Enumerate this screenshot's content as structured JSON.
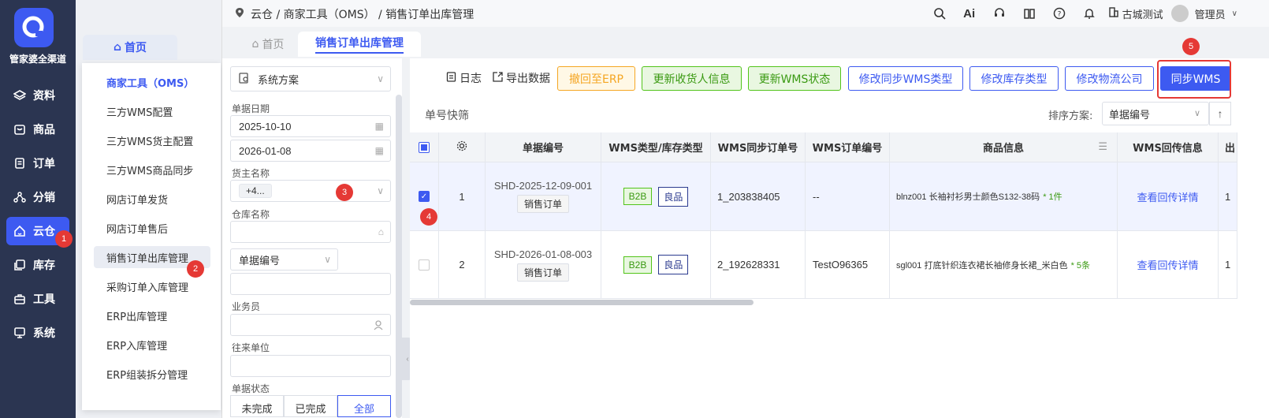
{
  "app": {
    "brand": "管家婆全渠道"
  },
  "nav": [
    {
      "label": "资料",
      "icon": "layers-icon"
    },
    {
      "label": "商品",
      "icon": "shop-icon"
    },
    {
      "label": "订单",
      "icon": "doc-icon"
    },
    {
      "label": "分销",
      "icon": "network-icon"
    },
    {
      "label": "云仓",
      "icon": "cloud-home-icon",
      "active": true
    },
    {
      "label": "库存",
      "icon": "stack-icon"
    },
    {
      "label": "工具",
      "icon": "toolbox-icon"
    },
    {
      "label": "系统",
      "icon": "monitor-icon"
    }
  ],
  "submenu": {
    "tab": "首页",
    "items": [
      "商家工具（OMS）",
      "三方WMS配置",
      "三方WMS货主配置",
      "三方WMS商品同步",
      "网店订单发货",
      "网店订单售后",
      "销售订单出库管理",
      "采购订单入库管理",
      "ERP出库管理",
      "ERP入库管理",
      "ERP组装拆分管理"
    ]
  },
  "breadcrumb": "云仓 / 商家工具（OMS） / 销售订单出库管理",
  "header": {
    "store": "古城测试",
    "user": "管理员",
    "ai": "Ai"
  },
  "tabs": {
    "home": "首页",
    "current": "销售订单出库管理"
  },
  "filter": {
    "scheme": "系统方案",
    "date_label": "单据日期",
    "date_from": "2025-10-10",
    "date_to": "2026-01-08",
    "owner_label": "货主名称",
    "owner_tag": "+4...",
    "warehouse_label": "仓库名称",
    "doc_field": "单据编号",
    "staff_label": "业务员",
    "partner_label": "往来单位",
    "status_label": "单据状态",
    "status_options": [
      "未完成",
      "已完成",
      "全部"
    ]
  },
  "toolbar": {
    "log": "日志",
    "export": "导出数据",
    "buttons": [
      "撤回至ERP",
      "更新收货人信息",
      "更新WMS状态",
      "修改同步WMS类型",
      "修改库存类型",
      "修改物流公司",
      "同步WMS"
    ]
  },
  "quick_filter": "单号快筛",
  "sort": {
    "label": "排序方案:",
    "value": "单据编号"
  },
  "table": {
    "columns": [
      "单据编号",
      "WMS类型/库存类型",
      "WMS同步订单号",
      "WMS订单编号",
      "商品信息",
      "WMS回传信息",
      "出"
    ],
    "rows": [
      {
        "idx": "1",
        "doc": "SHD-2025-12-09-001",
        "doctype": "销售订单",
        "wms_type": "B2B",
        "stock_type": "良品",
        "sync_no": "1_203838405",
        "wms_no": "--",
        "goods": "blnz001 长袖衬衫男士颜色S132-38码",
        "qty": "* 1件",
        "back": "查看回传详情",
        "last": "1"
      },
      {
        "idx": "2",
        "doc": "SHD-2026-01-08-003",
        "doctype": "销售订单",
        "wms_type": "B2B",
        "stock_type": "良品",
        "sync_no": "2_192628331",
        "wms_no": "TestO96365",
        "goods": "sgl001 打底针织连衣裙长袖修身长裙_米白色",
        "qty": "* 5条",
        "back": "查看回传详情",
        "last": "1"
      }
    ]
  },
  "markers": [
    "1",
    "2",
    "3",
    "4",
    "5"
  ]
}
